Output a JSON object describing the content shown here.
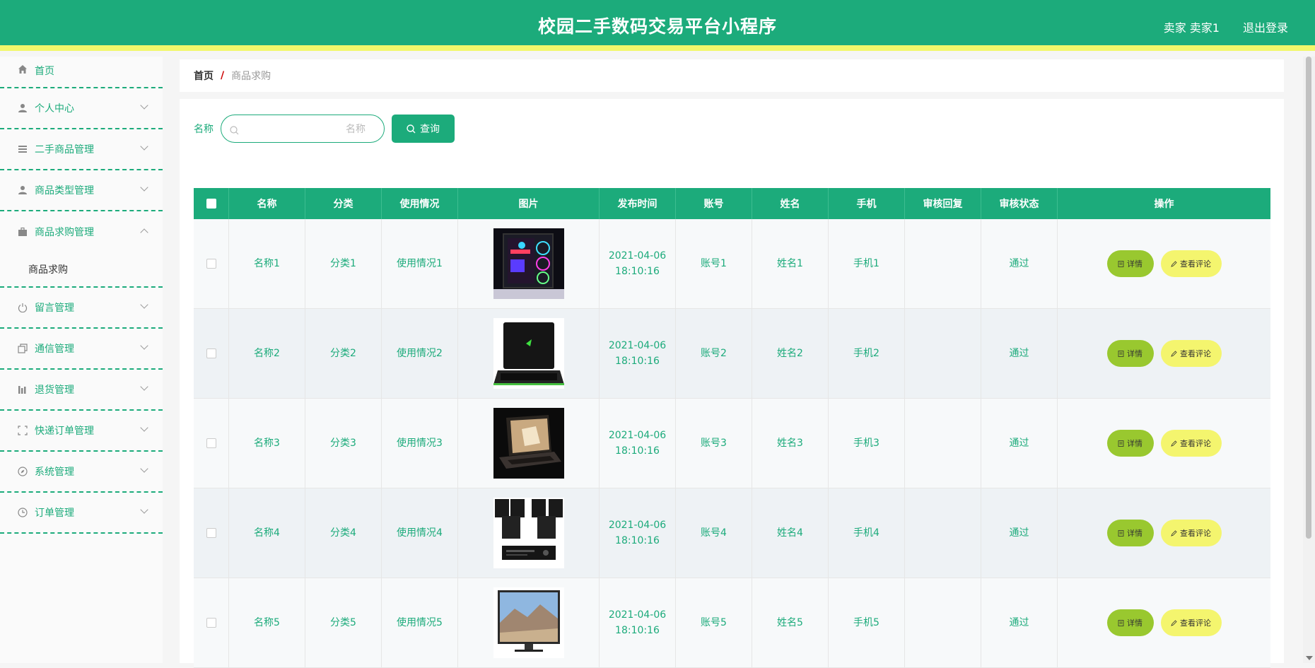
{
  "header": {
    "title": "校园二手数码交易平台小程序",
    "user": "卖家 卖家1",
    "logout": "退出登录",
    "color": "#1cab7b",
    "accent": "#f2f76b"
  },
  "sidebar": {
    "items": [
      {
        "label": "首页",
        "icon": "home-icon"
      },
      {
        "label": "个人中心",
        "icon": "person-icon"
      },
      {
        "label": "二手商品管理",
        "icon": "list-icon"
      },
      {
        "label": "商品类型管理",
        "icon": "person-icon"
      },
      {
        "label": "商品求购管理",
        "icon": "briefcase-icon",
        "expanded": true,
        "sub": "商品求购"
      },
      {
        "label": "留言管理",
        "icon": "power-icon"
      },
      {
        "label": "通信管理",
        "icon": "copy-icon"
      },
      {
        "label": "退货管理",
        "icon": "chart-icon"
      },
      {
        "label": "快递订单管理",
        "icon": "fullscreen-icon"
      },
      {
        "label": "系统管理",
        "icon": "compass-icon"
      },
      {
        "label": "订单管理",
        "icon": "clock-icon"
      }
    ]
  },
  "breadcrumb": {
    "home": "首页",
    "sep": "/",
    "current": "商品求购"
  },
  "search": {
    "label": "名称",
    "placeholder": "名称",
    "button": "查询"
  },
  "table": {
    "headers": [
      "名称",
      "分类",
      "使用情况",
      "图片",
      "发布时间",
      "账号",
      "姓名",
      "手机",
      "审核回复",
      "审核状态",
      "操作"
    ],
    "detail_label": "详情",
    "review_label": "查看评论",
    "rows": [
      {
        "name": "名称1",
        "category": "分类1",
        "usage": "使用情况1",
        "image": "desktop-pc",
        "date": "2021-04-06",
        "time": "18:10:16",
        "account": "账号1",
        "realname": "姓名1",
        "phone": "手机1",
        "reply": "",
        "status": "通过"
      },
      {
        "name": "名称2",
        "category": "分类2",
        "usage": "使用情况2",
        "image": "laptop",
        "date": "2021-04-06",
        "time": "18:10:16",
        "account": "账号2",
        "realname": "姓名2",
        "phone": "手机2",
        "reply": "",
        "status": "通过"
      },
      {
        "name": "名称3",
        "category": "分类3",
        "usage": "使用情况3",
        "image": "laptop-dark",
        "date": "2021-04-06",
        "time": "18:10:16",
        "account": "账号3",
        "realname": "姓名3",
        "phone": "手机3",
        "reply": "",
        "status": "通过"
      },
      {
        "name": "名称4",
        "category": "分类4",
        "usage": "使用情况4",
        "image": "speakers",
        "date": "2021-04-06",
        "time": "18:10:16",
        "account": "账号4",
        "realname": "姓名4",
        "phone": "手机4",
        "reply": "",
        "status": "通过"
      },
      {
        "name": "名称5",
        "category": "分类5",
        "usage": "使用情况5",
        "image": "monitor",
        "date": "2021-04-06",
        "time": "18:10:16",
        "account": "账号5",
        "realname": "姓名5",
        "phone": "手机5",
        "reply": "",
        "status": "通过"
      }
    ]
  }
}
